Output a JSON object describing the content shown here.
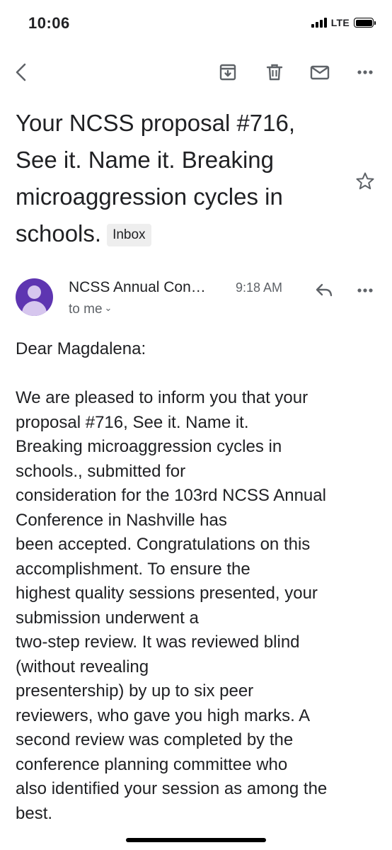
{
  "status_bar": {
    "time": "10:06",
    "network": "LTE",
    "battery_level": 1.0
  },
  "toolbar": {
    "back_icon": "chevron-left-icon",
    "archive_icon": "archive-icon",
    "delete_icon": "trash-icon",
    "mark_unread_icon": "mail-icon",
    "more_icon": "more-horizontal-icon"
  },
  "subject": {
    "lines": [
      "Your NCSS proposal #716,",
      "See it. Name it. Breaking",
      "microaggression cycles in",
      "schools."
    ],
    "label": "Inbox",
    "starred": false
  },
  "message": {
    "sender": "NCSS Annual Con…",
    "time": "9:18 AM",
    "recipient": "to me",
    "avatar_color": "#5e35b1",
    "greeting": "Dear Magdalena:",
    "body_lines": [
      "We are pleased to inform you that your",
      "proposal #716, See it. Name it.",
      "Breaking microaggression cycles in",
      "schools., submitted for",
      "consideration for the 103rd NCSS Annual",
      "Conference in Nashville has",
      "been accepted. Congratulations on this",
      "accomplishment. To ensure the",
      "highest quality sessions presented, your",
      "submission underwent a",
      "two-step review. It was reviewed blind",
      "(without revealing",
      "presentership) by up to six peer",
      "reviewers, who gave you high marks. A",
      "second review was completed by the",
      "conference planning committee who",
      "also identified your session as among the",
      "best."
    ]
  }
}
